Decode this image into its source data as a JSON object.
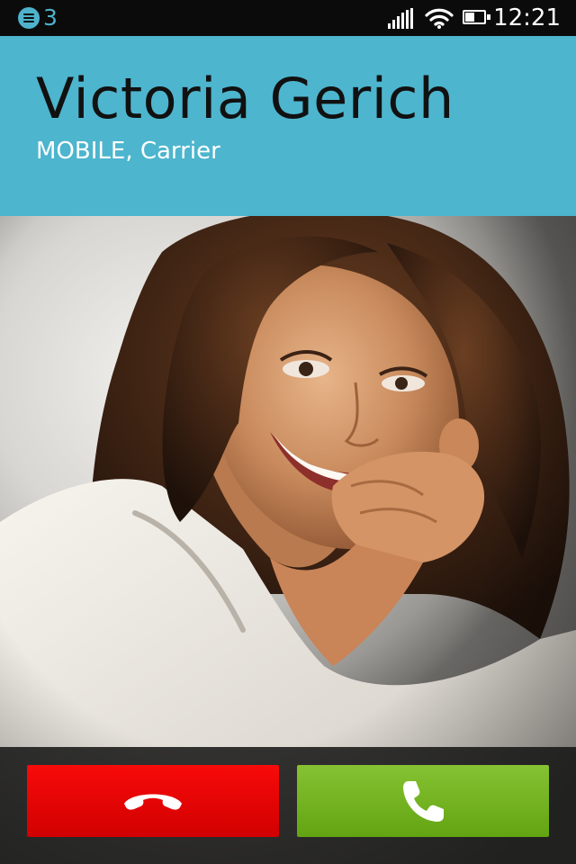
{
  "status_bar": {
    "notification_icon": "notification-list-icon",
    "notification_count": "3",
    "signal_icon": "cell-signal-icon",
    "wifi_icon": "wifi-icon",
    "battery_icon": "battery-icon",
    "battery_level": 0.5,
    "time": "12:21"
  },
  "caller": {
    "name": "Victoria Gerich",
    "info": "MOBILE, Carrier",
    "photo": "contact-photo"
  },
  "actions": {
    "decline_icon": "hang-up-icon",
    "accept_icon": "phone-answer-icon"
  },
  "colors": {
    "header_bg": "#4db5ce",
    "accent": "#4fb2cc",
    "decline": "#e80000",
    "accept": "#74b324"
  }
}
